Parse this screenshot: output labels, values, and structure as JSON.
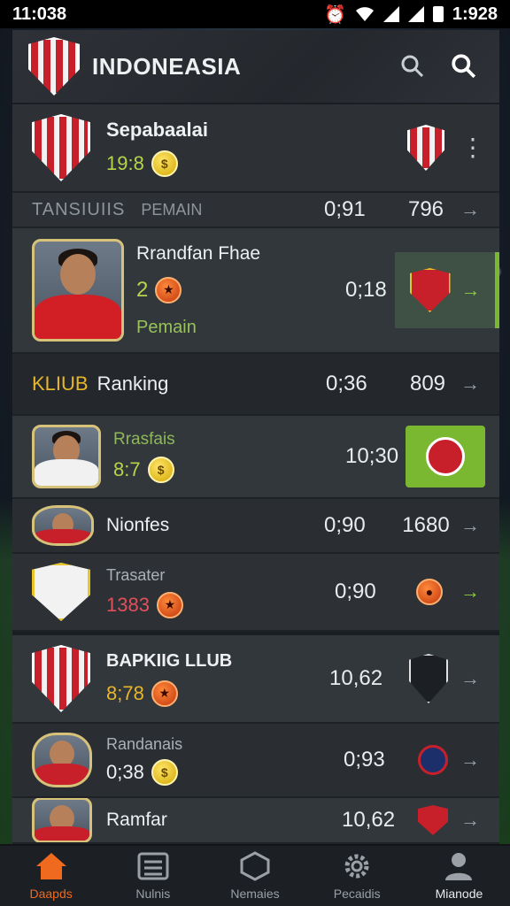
{
  "status_bar": {
    "time": "11:038",
    "right_time": "1:928"
  },
  "header": {
    "title": "INDONEASIA"
  },
  "rows": {
    "top": {
      "title": "Sepabaalai",
      "score": "19:8"
    },
    "labels": {
      "col1": "TANSIUIIS",
      "col2": "PEMAIN",
      "v1": "0;91",
      "v2": "796"
    },
    "player": {
      "name": "Rrandfan Fhae",
      "num": "2",
      "role": "Pemain",
      "v1": "0;18"
    },
    "club_ranking": {
      "prefix": "KLIUB",
      "label": "Ranking",
      "v1": "0;36",
      "v2": "809"
    },
    "r1": {
      "name": "Rrasfais",
      "score": "8:7",
      "v1": "10;30"
    },
    "r2": {
      "name": "Nionfes",
      "v1": "0;90",
      "v2": "1680"
    },
    "r3": {
      "name": "Trasater",
      "score": "1383",
      "v1": "0;90"
    },
    "club": {
      "name": "BAPKIIG LLUB",
      "score": "8;78",
      "v1": "10,62"
    },
    "r4": {
      "name": "Randanais",
      "score": "0;38",
      "v1": "0;93"
    },
    "r5": {
      "name": "Ramfar",
      "v1": "10,62"
    }
  },
  "tabs": [
    {
      "label": "Daapds"
    },
    {
      "label": "Nulnis"
    },
    {
      "label": "Nemaies"
    },
    {
      "label": "Pecaidis"
    },
    {
      "label": "Mianode"
    }
  ],
  "colors": {
    "accent": "#ef6a1e",
    "green": "#7bb832",
    "gold": "#e7c42a"
  }
}
